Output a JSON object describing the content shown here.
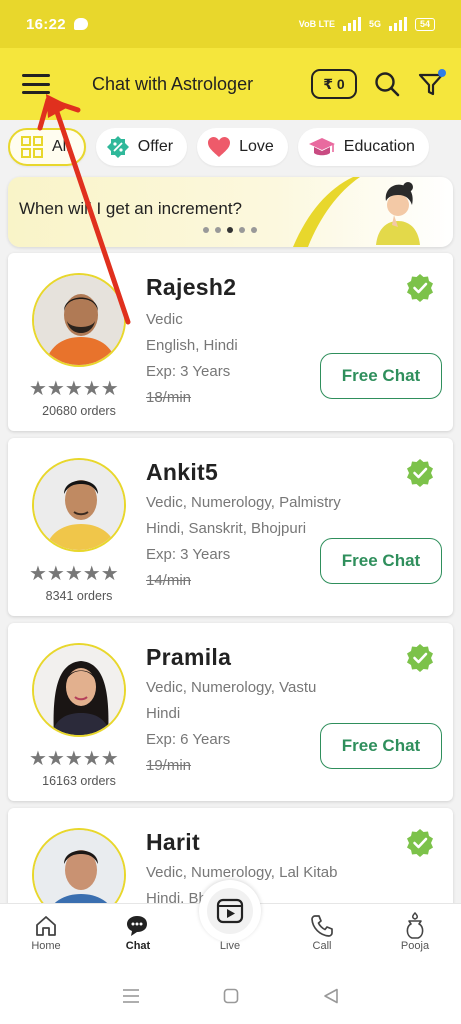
{
  "status_bar": {
    "time": "16:22",
    "network_label": "VoB LTE",
    "network2_label": "5G",
    "battery": "54"
  },
  "header": {
    "title": "Chat with Astrologer",
    "wallet": "₹ 0"
  },
  "filters": [
    {
      "label": "All",
      "icon": "grid-icon",
      "active": true
    },
    {
      "label": "Offer",
      "icon": "discount-icon"
    },
    {
      "label": "Love",
      "icon": "heart-icon"
    },
    {
      "label": "Education",
      "icon": "graduation-cap-icon"
    }
  ],
  "banner": {
    "question": "When will I get an increment?",
    "slide_count": 5,
    "active_slide": 3
  },
  "astrologers": [
    {
      "name": "Rajesh2",
      "skills": "Vedic",
      "languages": "English, Hindi",
      "experience": "Exp: 3 Years",
      "price": "18/min",
      "orders": "20680 orders",
      "rating": 5,
      "button": "Free Chat"
    },
    {
      "name": "Ankit5",
      "skills": "Vedic,  Numerology,  Palmistry",
      "languages": "Hindi, Sanskrit, Bhojpuri",
      "experience": "Exp: 3 Years",
      "price": "14/min",
      "orders": "8341 orders",
      "rating": 5,
      "button": "Free Chat"
    },
    {
      "name": "Pramila",
      "skills": "Vedic,  Numerology,  Vastu",
      "languages": "Hindi",
      "experience": "Exp: 6 Years",
      "price": "19/min",
      "orders": "16163 orders",
      "rating": 5,
      "button": "Free Chat"
    },
    {
      "name": "Harit",
      "skills": "Vedic,  Numerology,  Lal Kitab",
      "languages": "Hindi, Bh"
    }
  ],
  "bottom_nav": [
    {
      "label": "Home",
      "icon": "home-icon"
    },
    {
      "label": "Chat",
      "icon": "chat-icon",
      "active": true
    },
    {
      "label": "Live",
      "icon": "live-play-icon"
    },
    {
      "label": "Call",
      "icon": "phone-icon"
    },
    {
      "label": "Pooja",
      "icon": "kalash-icon"
    }
  ],
  "colors": {
    "brand_yellow": "#f5e63c",
    "status_yellow": "#e8d72c",
    "accent_green": "#2f8f5c",
    "verified_green": "#7cc24a",
    "annotation_red": "#e0301e"
  }
}
